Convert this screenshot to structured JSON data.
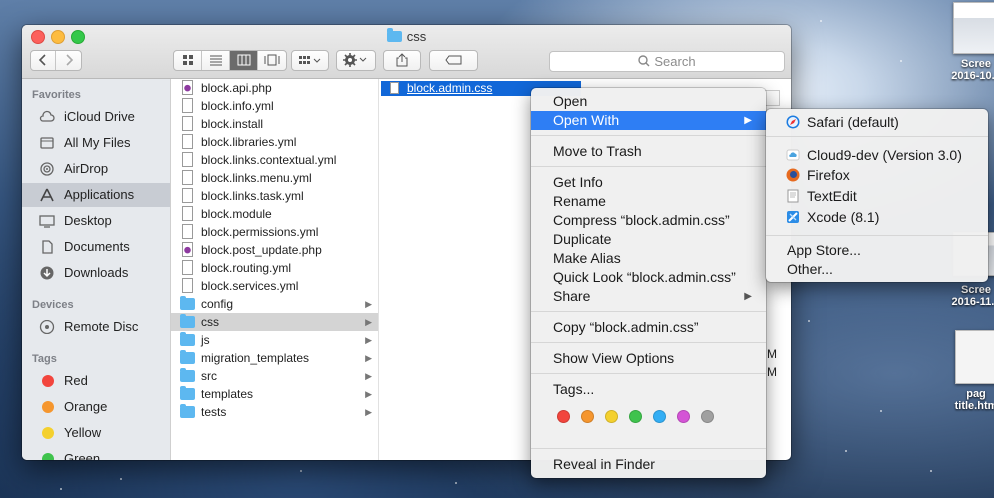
{
  "window": {
    "title": "css"
  },
  "toolbar": {
    "search_placeholder": "Search"
  },
  "sidebar": {
    "favorites_header": "Favorites",
    "favorites": [
      {
        "label": "iCloud Drive",
        "icon": "cloud-icon"
      },
      {
        "label": "All My Files",
        "icon": "all-files-icon"
      },
      {
        "label": "AirDrop",
        "icon": "airdrop-icon"
      },
      {
        "label": "Applications",
        "icon": "applications-icon",
        "selected": true
      },
      {
        "label": "Desktop",
        "icon": "desktop-icon"
      },
      {
        "label": "Documents",
        "icon": "documents-icon"
      },
      {
        "label": "Downloads",
        "icon": "downloads-icon"
      }
    ],
    "devices_header": "Devices",
    "devices": [
      {
        "label": "Remote Disc",
        "icon": "disc-icon"
      }
    ],
    "tags_header": "Tags",
    "tags": [
      {
        "label": "Red",
        "color": "#f2453d"
      },
      {
        "label": "Orange",
        "color": "#f5962e"
      },
      {
        "label": "Yellow",
        "color": "#f4d02e"
      },
      {
        "label": "Green",
        "color": "#3fc34d"
      }
    ]
  },
  "column1": {
    "files": [
      {
        "name": "block.api.php",
        "type": "php"
      },
      {
        "name": "block.info.yml",
        "type": "doc"
      },
      {
        "name": "block.install",
        "type": "doc"
      },
      {
        "name": "block.libraries.yml",
        "type": "doc"
      },
      {
        "name": "block.links.contextual.yml",
        "type": "doc"
      },
      {
        "name": "block.links.menu.yml",
        "type": "doc"
      },
      {
        "name": "block.links.task.yml",
        "type": "doc"
      },
      {
        "name": "block.module",
        "type": "doc"
      },
      {
        "name": "block.permissions.yml",
        "type": "doc"
      },
      {
        "name": "block.post_update.php",
        "type": "php"
      },
      {
        "name": "block.routing.yml",
        "type": "doc"
      },
      {
        "name": "block.services.yml",
        "type": "doc"
      }
    ],
    "folders": [
      {
        "name": "config"
      },
      {
        "name": "css",
        "selected": true
      },
      {
        "name": "js"
      },
      {
        "name": "migration_templates"
      },
      {
        "name": "src"
      },
      {
        "name": "templates"
      },
      {
        "name": "tests"
      }
    ]
  },
  "column2": {
    "selected_file": "block.admin.css",
    "partial_text_1": "M",
    "partial_text_2": "M"
  },
  "context_menu": {
    "open": "Open",
    "open_with": "Open With",
    "move_to_trash": "Move to Trash",
    "get_info": "Get Info",
    "rename": "Rename",
    "compress": "Compress “block.admin.css”",
    "duplicate": "Duplicate",
    "make_alias": "Make Alias",
    "quick_look": "Quick Look “block.admin.css”",
    "share": "Share",
    "copy": "Copy “block.admin.css”",
    "show_view_options": "Show View Options",
    "tags": "Tags...",
    "tag_colors": [
      "#f2453d",
      "#f5962e",
      "#f4d02e",
      "#3fc34d",
      "#33aef4",
      "#d454d6",
      "#a0a0a0"
    ],
    "reveal_in_finder": "Reveal in Finder"
  },
  "open_with_submenu": {
    "apps": [
      {
        "label": "Safari (default)",
        "icon": "safari-icon"
      },
      {
        "label": "Cloud9-dev (Version 3.0)",
        "icon": "cloud9-icon"
      },
      {
        "label": "Firefox",
        "icon": "firefox-icon"
      },
      {
        "label": "TextEdit",
        "icon": "textedit-icon"
      },
      {
        "label": "Xcode (8.1)",
        "icon": "xcode-icon"
      }
    ],
    "app_store": "App Store...",
    "other": "Other..."
  },
  "desktop": {
    "items": [
      {
        "line1": "Scree",
        "line2": "2016-10..."
      },
      {
        "line1": "Scree",
        "line2": "2016-11..."
      },
      {
        "line1": "pag",
        "line2": "title.htm"
      }
    ]
  }
}
